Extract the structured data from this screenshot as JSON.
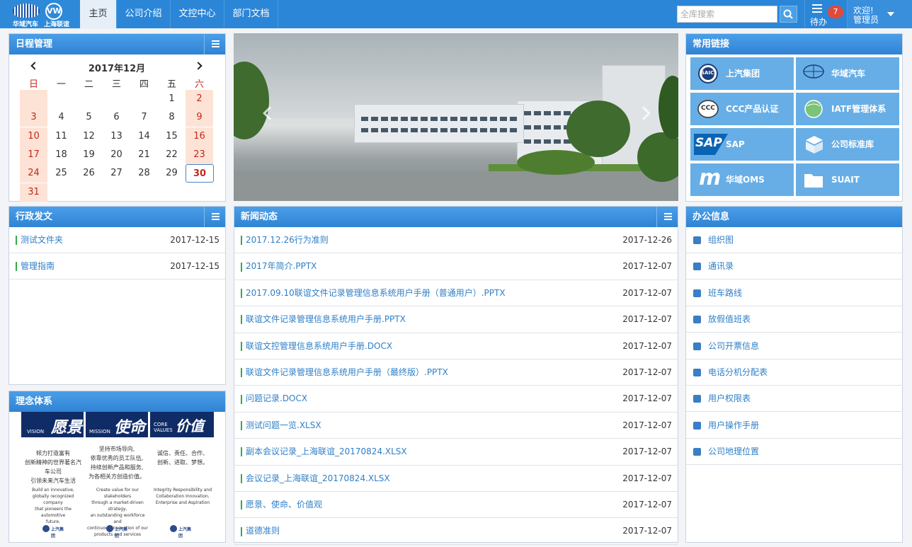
{
  "header": {
    "logo_text_1": "华域汽车",
    "logo_text_2": "上海联谊",
    "logo_mark": "VW",
    "nav": [
      {
        "label": "主页",
        "active": true
      },
      {
        "label": "公司介绍"
      },
      {
        "label": "文控中心"
      },
      {
        "label": "部门文档"
      }
    ],
    "search_placeholder": "全库搜索",
    "todo_label": "待办",
    "todo_count": "7",
    "welcome": "欢迎!",
    "user": "管理员"
  },
  "calendar": {
    "panel_title": "日程管理",
    "month_title": "2017年12月",
    "weekdays": [
      "日",
      "一",
      "二",
      "三",
      "四",
      "五",
      "六"
    ],
    "weeks": [
      [
        "",
        "",
        "",
        "",
        "",
        "1",
        "2"
      ],
      [
        "3",
        "4",
        "5",
        "6",
        "7",
        "8",
        "9"
      ],
      [
        "10",
        "11",
        "12",
        "13",
        "14",
        "15",
        "16"
      ],
      [
        "17",
        "18",
        "19",
        "20",
        "21",
        "22",
        "23"
      ],
      [
        "24",
        "25",
        "26",
        "27",
        "28",
        "29",
        "30"
      ],
      [
        "31",
        "",
        "",
        "",
        "",
        "",
        ""
      ]
    ],
    "today": "30"
  },
  "admin_docs": {
    "panel_title": "行政发文",
    "items": [
      {
        "title": "测试文件夹",
        "date": "2017-12-15"
      },
      {
        "title": "管理指南",
        "date": "2017-12-15"
      }
    ]
  },
  "concept": {
    "panel_title": "理念体系",
    "bands": [
      {
        "en": "VISION",
        "cn": "愿景"
      },
      {
        "en": "MISSION",
        "cn": "使命"
      },
      {
        "en": "CORE VALUES",
        "cn": "价值观"
      }
    ],
    "texts": [
      "倾力打造富有\n创新精神的世界著名汽车公司\n引领未来汽车生活",
      "坚持市场导向,\n依靠优秀的员工队伍,\n持续创新产品和服务,\n为各相关方创造价值。",
      "诚信、责任、合作、\n创新、进取、梦想。"
    ],
    "en_texts": [
      "Build an innovative,\nglobally recognized company\nthat pioneers the automotive\nfuture.",
      "Create value for our stakeholders\nthrough a market-driven strategy,\nan outstanding workforce and\ncontinuous innovation of our\nproducts and services",
      "Integrity Responsibility and\nCollaboration Innovation,\nEnterprise and Aspiration"
    ],
    "logo_text": "上汽集团"
  },
  "news": {
    "panel_title": "新闻动态",
    "items": [
      {
        "title": "2017.12.26行为准则",
        "date": "2017-12-26"
      },
      {
        "title": "2017年简介.PPTX",
        "date": "2017-12-07"
      },
      {
        "title": "2017.09.10联谊文件记录管理信息系统用户手册（普通用户）.PPTX",
        "date": "2017-12-07"
      },
      {
        "title": "联谊文件记录管理信息系统用户手册.PPTX",
        "date": "2017-12-07"
      },
      {
        "title": "联谊文控管理信息系统用户手册.DOCX",
        "date": "2017-12-07"
      },
      {
        "title": "联谊文件记录管理信息系统用户手册（最终版）.PPTX",
        "date": "2017-12-07"
      },
      {
        "title": "问题记录.DOCX",
        "date": "2017-12-07"
      },
      {
        "title": "测试问题一览.XLSX",
        "date": "2017-12-07"
      },
      {
        "title": "副本会议记录_上海联谊_20170824.XLSX",
        "date": "2017-12-07"
      },
      {
        "title": "会议记录_上海联谊_20170824.XLSX",
        "date": "2017-12-07"
      },
      {
        "title": "愿景、使命、价值观",
        "date": "2017-12-07"
      },
      {
        "title": "道德准则",
        "date": "2017-12-07"
      }
    ]
  },
  "links": {
    "panel_title": "常用链接",
    "items": [
      {
        "label": "上汽集团",
        "icon": "saic-logo-icon"
      },
      {
        "label": "华域汽车",
        "icon": "huayu-logo-icon"
      },
      {
        "label": "CCC产品认证",
        "icon": "ccc-logo-icon"
      },
      {
        "label": "IATF管理体系",
        "icon": "iatf-globe-icon"
      },
      {
        "label": "SAP",
        "icon": "sap-logo-icon"
      },
      {
        "label": "公司标准库",
        "icon": "cubes-icon"
      },
      {
        "label": "华域OMS",
        "icon": "oms-logo-icon"
      },
      {
        "label": "SUAIT",
        "icon": "folder-icon"
      }
    ],
    "sap_mark": "SAP",
    "oms_mark": "m",
    "ccc_mark": "CCC",
    "saic_mark": "SAIC"
  },
  "office": {
    "panel_title": "办公信息",
    "items": [
      {
        "label": "组织图",
        "icon": "org-chart-icon"
      },
      {
        "label": "通讯录",
        "icon": "user-icon"
      },
      {
        "label": "班车路线",
        "icon": "bus-icon"
      },
      {
        "label": "放假值班表",
        "icon": "calendar-icon"
      },
      {
        "label": "公司开票信息",
        "icon": "list-icon"
      },
      {
        "label": "电话分机分配表",
        "icon": "headset-icon"
      },
      {
        "label": "用户权限表",
        "icon": "bar-chart-icon"
      },
      {
        "label": "用户操作手册",
        "icon": "book-icon"
      },
      {
        "label": "公司地理位置",
        "icon": "globe-icon"
      }
    ]
  },
  "colors": {
    "header_blue": "#2c86d8",
    "panel_head": "#3a8fdc",
    "link_tile": "#67aee6",
    "weekend_bg": "#fde3d6",
    "weekend_text": "#c4281c",
    "link_text": "#2f7fc7",
    "bullet_green": "#3aa84a",
    "badge_red": "#e04a3a"
  }
}
